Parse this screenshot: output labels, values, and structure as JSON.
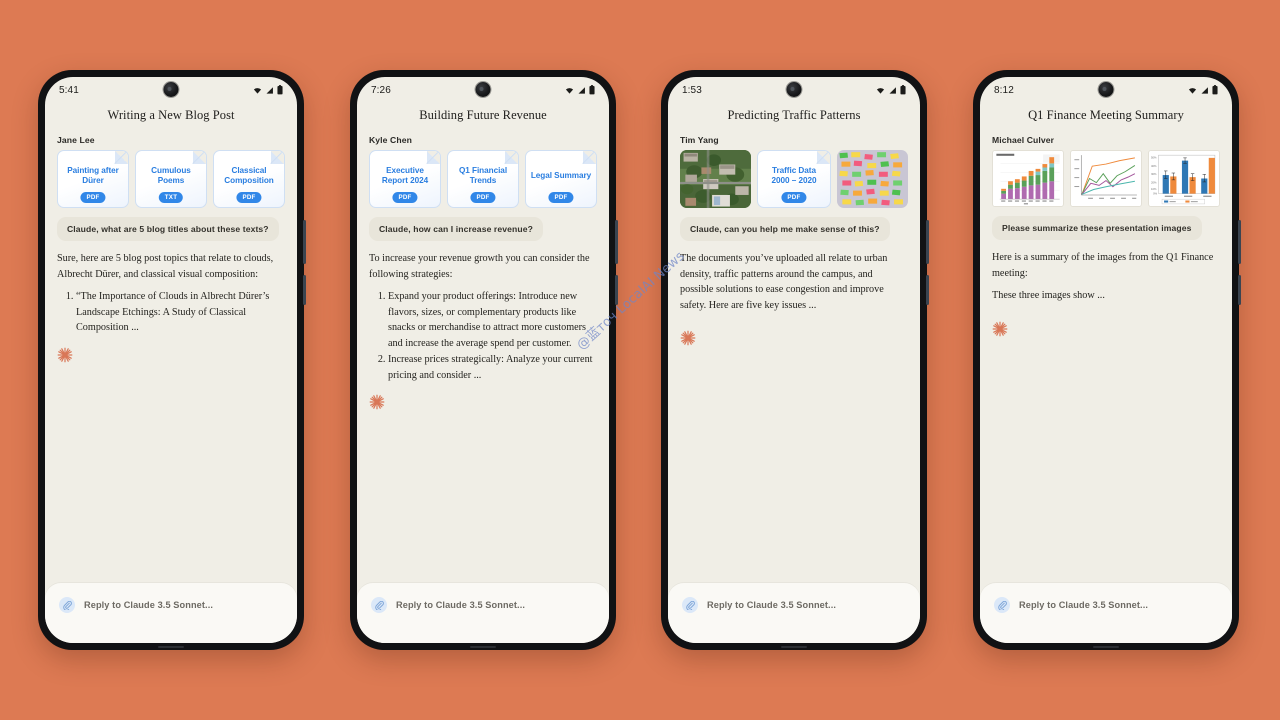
{
  "background_color": "#DD7A53",
  "watermark": "@蓝точ LocalAI News",
  "composer": {
    "placeholder": "Reply to Claude 3.5 Sonnet...",
    "attach_icon": "paperclip-icon"
  },
  "status_icons": [
    "wifi-icon",
    "signal-icon",
    "battery-icon"
  ],
  "phones": [
    {
      "id": "phone-1",
      "time": "5:41",
      "title": "Writing a New Blog Post",
      "author": "Jane Lee",
      "attachments": [
        {
          "kind": "file",
          "name": "Painting after Dürer",
          "type": "PDF"
        },
        {
          "kind": "file",
          "name": "Cumulous Poems",
          "type": "TXT"
        },
        {
          "kind": "file",
          "name": "Classical Composition",
          "type": "PDF"
        }
      ],
      "prompt": "Claude, what are 5 blog titles about these texts?",
      "answer_paragraphs": [
        "Sure, here are 5 blog post topics that relate to clouds, Albrecht Dürer, and classical visual composition:"
      ],
      "answer_list": [
        "“The Importance of Clouds in Albrecht Dürer’s Landscape Etchings: A Study of Classical Composition ..."
      ]
    },
    {
      "id": "phone-2",
      "time": "7:26",
      "title": "Building Future Revenue",
      "author": "Kyle Chen",
      "attachments": [
        {
          "kind": "file",
          "name": "Executive Report 2024",
          "type": "PDF"
        },
        {
          "kind": "file",
          "name": "Q1 Financial Trends",
          "type": "PDF"
        },
        {
          "kind": "file",
          "name": "Legal Summary",
          "type": "PDF"
        }
      ],
      "prompt": "Claude, how can I increase revenue?",
      "answer_paragraphs": [
        "To increase your revenue growth you can consider the following strategies:"
      ],
      "answer_list": [
        "Expand your product offerings: Introduce new flavors, sizes, or complementary products like snacks or merchandise to attract more customers and increase the average spend per customer.",
        "Increase prices strategically: Analyze your current pricing and consider ..."
      ]
    },
    {
      "id": "phone-3",
      "time": "1:53",
      "title": "Predicting Traffic Patterns",
      "author": "Tim Yang",
      "attachments": [
        {
          "kind": "photo",
          "name": "aerial-campus-photo"
        },
        {
          "kind": "file",
          "name": "Traffic Data 2000 – 2020",
          "type": "PDF"
        },
        {
          "kind": "photo",
          "name": "sticky-notes-photo"
        }
      ],
      "prompt": "Claude, can you help me make sense of this?",
      "answer_paragraphs": [
        "The documents you’ve uploaded all relate to urban density, traffic patterns around the campus, and possible solutions to ease congestion and improve safety. Here are five key issues ..."
      ],
      "answer_list": []
    },
    {
      "id": "phone-4",
      "time": "8:12",
      "title": "Q1 Finance Meeting Summary",
      "author": "Michael Culver",
      "attachments": [
        {
          "kind": "chart",
          "name": "stacked-bar-chart-thumbnail"
        },
        {
          "kind": "chart",
          "name": "multi-line-chart-thumbnail"
        },
        {
          "kind": "chart",
          "name": "grouped-bar-chart-thumbnail"
        }
      ],
      "prompt": "Please summarize these presentation images",
      "answer_paragraphs": [
        "Here is a summary of the images from the Q1 Finance meeting:",
        "These three images show ..."
      ],
      "answer_list": []
    }
  ]
}
